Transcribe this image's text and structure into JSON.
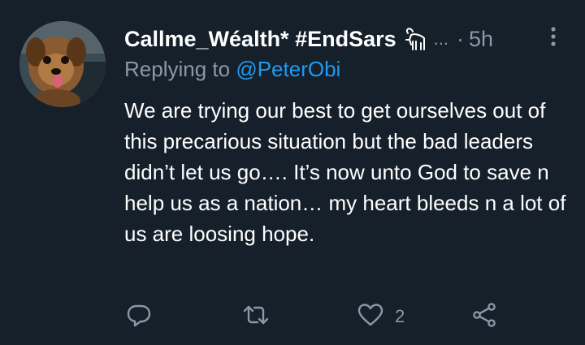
{
  "tweet": {
    "display_name": "Callme_Wéalth* #EndSars",
    "name_ellipsis": "...",
    "separator": "·",
    "timestamp": "5h",
    "replying_prefix": "Replying to",
    "replying_to": "@PeterObi",
    "text": "We are trying our best to get ourselves out of this precarious situation but the bad leaders didn’t let us go…. It’s now unto God to save n help us as a nation… my heart bleeds n a lot of us are loosing hope.",
    "avatar_icon": "dog-photo-avatar",
    "badge_icon": "goat-emoji-icon"
  },
  "actions": {
    "reply": {
      "icon": "reply-icon",
      "count": ""
    },
    "retweet": {
      "icon": "retweet-icon",
      "count": ""
    },
    "like": {
      "icon": "heart-icon",
      "count": "2"
    },
    "share": {
      "icon": "share-icon",
      "count": ""
    }
  },
  "colors": {
    "background": "#15202b",
    "text": "#ffffff",
    "secondary": "#8b98a5",
    "link": "#1d9bf0"
  }
}
